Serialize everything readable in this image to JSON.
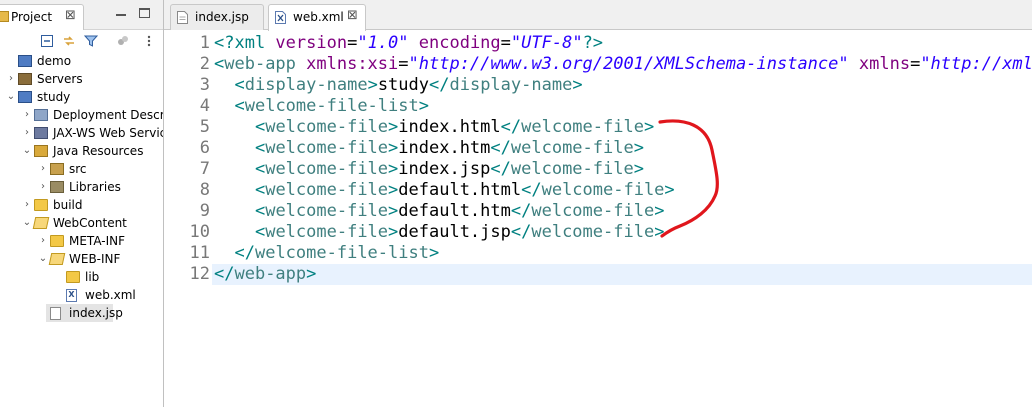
{
  "explorer": {
    "tab_label": "Project",
    "close_glyph": "⊠",
    "tree": [
      {
        "label": "demo",
        "icon": "project-icon",
        "level": 0,
        "arrow": ""
      },
      {
        "label": "Servers",
        "icon": "servers-folder-icon",
        "level": 0,
        "arrow": "›"
      },
      {
        "label": "study",
        "icon": "project-icon",
        "level": 0,
        "arrow": "⌄"
      },
      {
        "label": "Deployment Descripto",
        "icon": "deployment-descriptor-icon",
        "level": 1,
        "arrow": "›"
      },
      {
        "label": "JAX-WS Web Services",
        "icon": "jaxws-icon",
        "level": 1,
        "arrow": "›"
      },
      {
        "label": "Java Resources",
        "icon": "java-resources-icon",
        "level": 1,
        "arrow": "⌄"
      },
      {
        "label": "src",
        "icon": "source-folder-icon",
        "level": 2,
        "arrow": "›"
      },
      {
        "label": "Libraries",
        "icon": "libraries-icon",
        "level": 2,
        "arrow": "›"
      },
      {
        "label": "build",
        "icon": "folder-icon",
        "level": 1,
        "arrow": "›"
      },
      {
        "label": "WebContent",
        "icon": "folder-open-icon",
        "level": 1,
        "arrow": "⌄"
      },
      {
        "label": "META-INF",
        "icon": "folder-icon",
        "level": 2,
        "arrow": "›"
      },
      {
        "label": "WEB-INF",
        "icon": "folder-open-icon",
        "level": 2,
        "arrow": "⌄"
      },
      {
        "label": "lib",
        "icon": "folder-icon",
        "level": 3,
        "arrow": ""
      },
      {
        "label": "web.xml",
        "icon": "xml-file-icon",
        "level": 3,
        "arrow": ""
      },
      {
        "label": "index.jsp",
        "icon": "jsp-file-icon",
        "level": 2,
        "arrow": "",
        "selected": true
      }
    ]
  },
  "editor": {
    "tabs": [
      {
        "label": "index.jsp",
        "icon": "jsp-file-icon",
        "active": false
      },
      {
        "label": "web.xml",
        "icon": "xml-file-icon",
        "active": true,
        "close": "⊠"
      }
    ],
    "current_line": 12,
    "lines": [
      {
        "n": "1",
        "tokens": [
          [
            "pi",
            "<?xml "
          ],
          [
            "attr",
            "version"
          ],
          [
            "text",
            "="
          ],
          [
            "val",
            "\"1.0\""
          ],
          [
            "text",
            " "
          ],
          [
            "attr",
            "encoding"
          ],
          [
            "text",
            "="
          ],
          [
            "val",
            "\"UTF-8\""
          ],
          [
            "pi",
            "?>"
          ]
        ]
      },
      {
        "n": "2",
        "tokens": [
          [
            "bracket",
            "<"
          ],
          [
            "tag",
            "web-app "
          ],
          [
            "attr",
            "xmlns:xsi"
          ],
          [
            "text",
            "="
          ],
          [
            "val",
            "\"http://www.w3.org/2001/XMLSchema-instance\""
          ],
          [
            "text",
            " "
          ],
          [
            "attr",
            "xmlns"
          ],
          [
            "text",
            "="
          ],
          [
            "val",
            "\"http://xmlns.jcp.org/xml/ns/javaee\""
          ]
        ]
      },
      {
        "n": "3",
        "tokens": [
          [
            "text",
            "  "
          ],
          [
            "bracket",
            "<"
          ],
          [
            "tag",
            "display-name"
          ],
          [
            "bracket",
            ">"
          ],
          [
            "text",
            "study"
          ],
          [
            "bracket",
            "</"
          ],
          [
            "tag",
            "display-name"
          ],
          [
            "bracket",
            ">"
          ]
        ]
      },
      {
        "n": "4",
        "tokens": [
          [
            "text",
            "  "
          ],
          [
            "bracket",
            "<"
          ],
          [
            "tag",
            "welcome-file-list"
          ],
          [
            "bracket",
            ">"
          ]
        ]
      },
      {
        "n": "5",
        "tokens": [
          [
            "text",
            "    "
          ],
          [
            "bracket",
            "<"
          ],
          [
            "tag",
            "welcome-file"
          ],
          [
            "bracket",
            ">"
          ],
          [
            "text",
            "index.html"
          ],
          [
            "bracket",
            "</"
          ],
          [
            "tag",
            "welcome-file"
          ],
          [
            "bracket",
            ">"
          ]
        ]
      },
      {
        "n": "6",
        "tokens": [
          [
            "text",
            "    "
          ],
          [
            "bracket",
            "<"
          ],
          [
            "tag",
            "welcome-file"
          ],
          [
            "bracket",
            ">"
          ],
          [
            "text",
            "index.htm"
          ],
          [
            "bracket",
            "</"
          ],
          [
            "tag",
            "welcome-file"
          ],
          [
            "bracket",
            ">"
          ]
        ]
      },
      {
        "n": "7",
        "tokens": [
          [
            "text",
            "    "
          ],
          [
            "bracket",
            "<"
          ],
          [
            "tag",
            "welcome-file"
          ],
          [
            "bracket",
            ">"
          ],
          [
            "text",
            "index.jsp"
          ],
          [
            "bracket",
            "</"
          ],
          [
            "tag",
            "welcome-file"
          ],
          [
            "bracket",
            ">"
          ]
        ]
      },
      {
        "n": "8",
        "tokens": [
          [
            "text",
            "    "
          ],
          [
            "bracket",
            "<"
          ],
          [
            "tag",
            "welcome-file"
          ],
          [
            "bracket",
            ">"
          ],
          [
            "text",
            "default.html"
          ],
          [
            "bracket",
            "</"
          ],
          [
            "tag",
            "welcome-file"
          ],
          [
            "bracket",
            ">"
          ]
        ]
      },
      {
        "n": "9",
        "tokens": [
          [
            "text",
            "    "
          ],
          [
            "bracket",
            "<"
          ],
          [
            "tag",
            "welcome-file"
          ],
          [
            "bracket",
            ">"
          ],
          [
            "text",
            "default.htm"
          ],
          [
            "bracket",
            "</"
          ],
          [
            "tag",
            "welcome-file"
          ],
          [
            "bracket",
            ">"
          ]
        ]
      },
      {
        "n": "10",
        "tokens": [
          [
            "text",
            "    "
          ],
          [
            "bracket",
            "<"
          ],
          [
            "tag",
            "welcome-file"
          ],
          [
            "bracket",
            ">"
          ],
          [
            "text",
            "default.jsp"
          ],
          [
            "bracket",
            "</"
          ],
          [
            "tag",
            "welcome-file"
          ],
          [
            "bracket",
            ">"
          ]
        ]
      },
      {
        "n": "11",
        "tokens": [
          [
            "text",
            "  "
          ],
          [
            "bracket",
            "</"
          ],
          [
            "tag",
            "welcome-file-list"
          ],
          [
            "bracket",
            ">"
          ]
        ]
      },
      {
        "n": "12",
        "tokens": [
          [
            "bracket",
            "</"
          ],
          [
            "tag",
            "web-app"
          ],
          [
            "bracket",
            ">"
          ]
        ]
      }
    ]
  },
  "colors": {
    "annotation": "#e0161c",
    "current_line": "#e8f2fe"
  }
}
